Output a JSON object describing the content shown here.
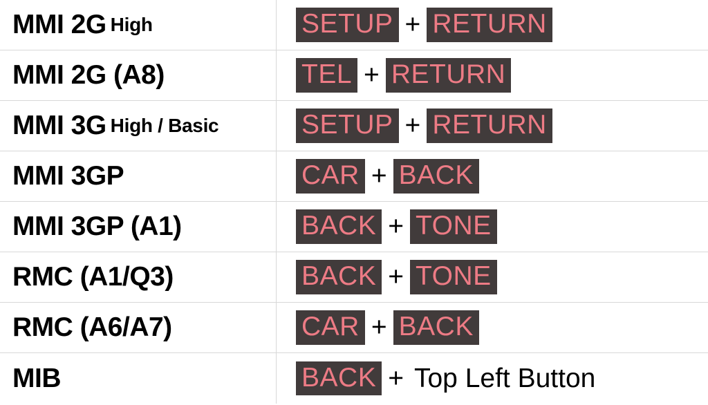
{
  "rows": [
    {
      "system": "MMI 2G",
      "sub": "High",
      "combo": [
        {
          "type": "key",
          "text": "SETUP"
        },
        {
          "type": "plus",
          "text": "+"
        },
        {
          "type": "key",
          "text": "RETURN"
        }
      ]
    },
    {
      "system": "MMI 2G (A8)",
      "sub": "",
      "combo": [
        {
          "type": "key",
          "text": "TEL"
        },
        {
          "type": "plus",
          "text": "+"
        },
        {
          "type": "key",
          "text": "RETURN"
        }
      ]
    },
    {
      "system": "MMI 3G",
      "sub": "High / Basic",
      "combo": [
        {
          "type": "key",
          "text": "SETUP"
        },
        {
          "type": "plus",
          "text": "+"
        },
        {
          "type": "key",
          "text": "RETURN"
        }
      ]
    },
    {
      "system": "MMI 3GP",
      "sub": "",
      "combo": [
        {
          "type": "key",
          "text": "CAR"
        },
        {
          "type": "plus",
          "text": "+"
        },
        {
          "type": "key",
          "text": "BACK"
        }
      ]
    },
    {
      "system": "MMI 3GP (A1)",
      "sub": "",
      "combo": [
        {
          "type": "key",
          "text": "BACK"
        },
        {
          "type": "plus",
          "text": "+"
        },
        {
          "type": "key",
          "text": "TONE"
        }
      ]
    },
    {
      "system": "RMC (A1/Q3)",
      "sub": "",
      "combo": [
        {
          "type": "key",
          "text": "BACK"
        },
        {
          "type": "plus",
          "text": "+"
        },
        {
          "type": "key",
          "text": "TONE"
        }
      ]
    },
    {
      "system": "RMC (A6/A7)",
      "sub": "",
      "combo": [
        {
          "type": "key",
          "text": "CAR"
        },
        {
          "type": "plus",
          "text": "+"
        },
        {
          "type": "key",
          "text": "BACK"
        }
      ]
    },
    {
      "system": "MIB",
      "sub": "",
      "combo": [
        {
          "type": "key",
          "text": "BACK"
        },
        {
          "type": "plus",
          "text": "+"
        },
        {
          "type": "plain",
          "text": "Top Left Button"
        }
      ]
    }
  ]
}
